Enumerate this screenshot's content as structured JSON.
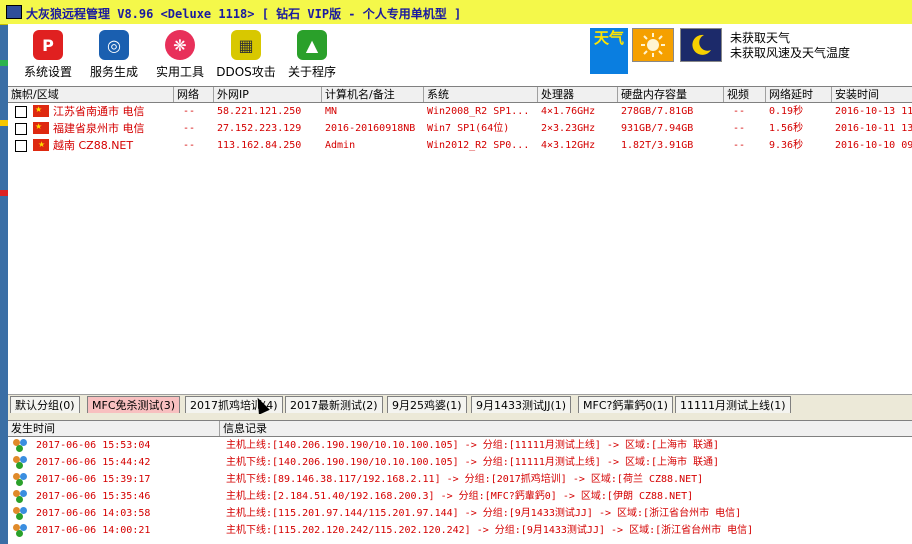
{
  "window": {
    "title": "大灰狼远程管理 V8.96 <Deluxe 1118> [ 钻石 VIP版 - 个人专用单机型 ]"
  },
  "toolbar": {
    "buttons": [
      {
        "label": "系统设置",
        "icon": "settings-icon",
        "color": "#e02020"
      },
      {
        "label": "服务生成",
        "icon": "build-icon",
        "color": "#1a5fb0"
      },
      {
        "label": "实用工具",
        "icon": "tools-icon",
        "color": "#e8305a"
      },
      {
        "label": "DDOS攻击",
        "icon": "ddos-icon",
        "color": "#d8c800"
      },
      {
        "label": "关于程序",
        "icon": "about-icon",
        "color": "#2aa02a"
      }
    ],
    "weather_tag": "天气",
    "weather_line1": "未获取天气",
    "weather_line2": "未获取风速及天气温度"
  },
  "hosts": {
    "columns": [
      "旗帜/区域",
      "网络",
      "外网IP",
      "计算机名/备注",
      "系统",
      "处理器",
      "硬盘内存容量",
      "视频",
      "网络延时",
      "安装时间"
    ],
    "rows": [
      [
        "江苏省南通市 电信",
        "--",
        "58.221.121.250",
        "MN",
        "Win2008_R2 SP1...",
        "4×1.76GHz",
        "278GB/7.81GB",
        "--",
        "0.19秒",
        "2016-10-13 11"
      ],
      [
        "福建省泉州市 电信",
        "--",
        "27.152.223.129",
        "2016-20160918NB",
        "Win7 SP1(64位)",
        "2×3.23GHz",
        "931GB/7.94GB",
        "--",
        "1.56秒",
        "2016-10-11 13"
      ],
      [
        "越南  CZ88.NET",
        "--",
        "113.162.84.250",
        "Admin",
        "Win2012_R2 SP0...",
        "4×3.12GHz",
        "1.82T/3.91GB",
        "--",
        "9.36秒",
        "2016-10-10 09"
      ]
    ]
  },
  "groups": {
    "tabs": [
      "默认分组(0)",
      "MFC免杀测试(3)",
      "2017抓鸡培训(4)",
      "2017最新测试(2)",
      "9月25鸡婆(1)",
      "9月1433测试JJ(1)",
      "MFC?鈣輩鈣0(1)",
      "11111月测试上线(1)"
    ],
    "active": 1
  },
  "log": {
    "columns": [
      "发生时间",
      "信息记录"
    ],
    "rows": [
      [
        "2017-06-06 15:53:04",
        "主机上线:[140.206.190.190/10.10.100.105] -> 分组:[11111月测试上线] -> 区域:[上海市 联通]"
      ],
      [
        "2017-06-06 15:44:42",
        "主机下线:[140.206.190.190/10.10.100.105] -> 分组:[11111月测试上线] -> 区域:[上海市 联通]"
      ],
      [
        "2017-06-06 15:39:17",
        "主机下线:[89.146.38.117/192.168.2.11] -> 分组:[2017抓鸡培训] -> 区域:[荷兰  CZ88.NET]"
      ],
      [
        "2017-06-06 15:35:46",
        "主机上线:[2.184.51.40/192.168.200.3] -> 分组:[MFC?鈣輩鈣0] -> 区域:[伊朗  CZ88.NET]"
      ],
      [
        "2017-06-06 14:03:58",
        "主机上线:[115.201.97.144/115.201.97.144] -> 分组:[9月1433测试JJ] -> 区域:[浙江省台州市 电信]"
      ],
      [
        "2017-06-06 14:00:21",
        "主机下线:[115.202.120.242/115.202.120.242] -> 分组:[9月1433测试JJ] -> 区域:[浙江省台州市 电信]"
      ]
    ]
  }
}
